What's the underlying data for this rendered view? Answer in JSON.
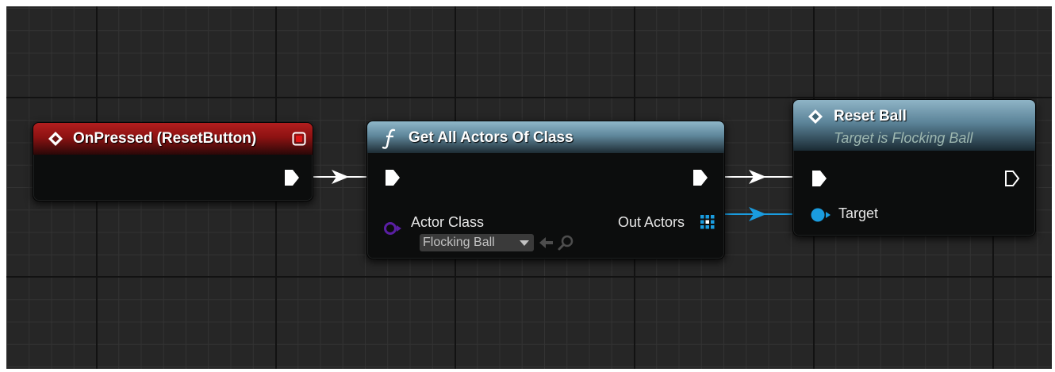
{
  "graph": {
    "nodes": {
      "on_pressed": {
        "title": "OnPressed (ResetButton)",
        "icon": "event-diamond-icon",
        "accent": "#8d1212"
      },
      "get_all_actors": {
        "title": "Get All Actors Of Class",
        "icon": "function-f-icon",
        "accent": "#5f879b",
        "inputs": {
          "actor_class_label": "Actor Class",
          "actor_class_value": "Flocking Ball"
        },
        "outputs": {
          "out_actors_label": "Out Actors"
        }
      },
      "reset_ball": {
        "title": "Reset Ball",
        "subtitle": "Target is Flocking Ball",
        "icon": "event-diamond-icon",
        "accent": "#5b8398",
        "inputs": {
          "target_label": "Target"
        }
      }
    },
    "colors": {
      "exec_wire": "#ffffff",
      "object_wire": "#1a9cdf",
      "class_pin": "#5a1fa3"
    }
  }
}
